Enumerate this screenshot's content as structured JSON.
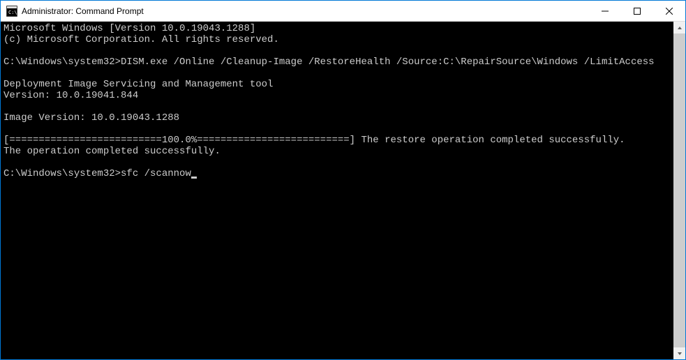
{
  "window": {
    "title": "Administrator: Command Prompt"
  },
  "terminal": {
    "lines": [
      "Microsoft Windows [Version 10.0.19043.1288]",
      "(c) Microsoft Corporation. All rights reserved.",
      "",
      "C:\\Windows\\system32>DISM.exe /Online /Cleanup-Image /RestoreHealth /Source:C:\\RepairSource\\Windows /LimitAccess",
      "",
      "Deployment Image Servicing and Management tool",
      "Version: 10.0.19041.844",
      "",
      "Image Version: 10.0.19043.1288",
      "",
      "[==========================100.0%==========================] The restore operation completed successfully.",
      "The operation completed successfully.",
      ""
    ],
    "current_prompt": "C:\\Windows\\system32>",
    "current_input": "sfc /scannow"
  }
}
